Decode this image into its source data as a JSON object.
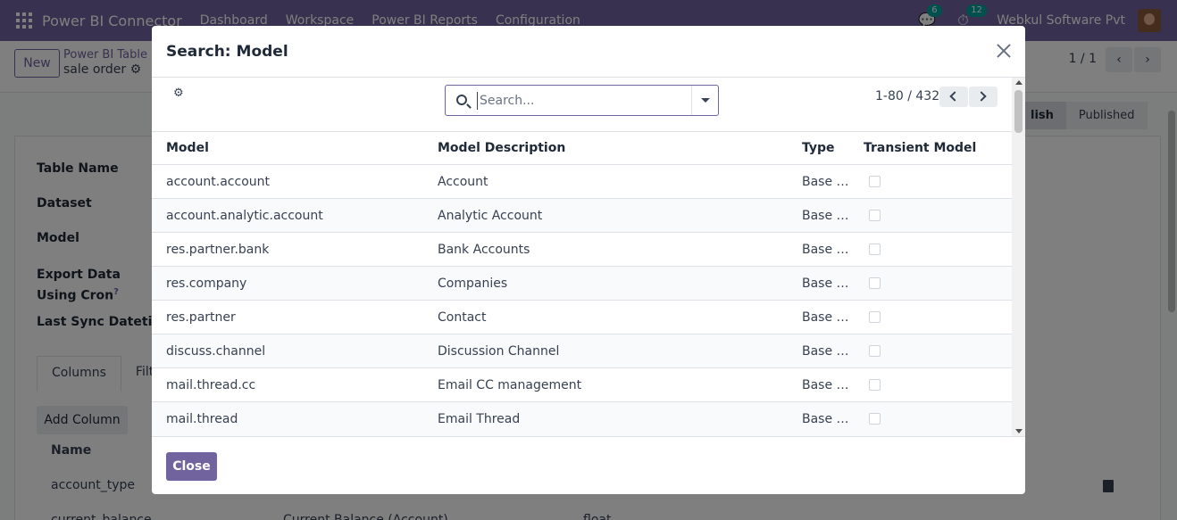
{
  "navbar": {
    "brand": "Power BI Connector",
    "menu": [
      "Dashboard",
      "Workspace",
      "Power BI Reports",
      "Configuration"
    ],
    "messages_count": "6",
    "activities_count": "12",
    "company": "Webkul Software Pvt"
  },
  "control_panel": {
    "new_label": "New",
    "breadcrumb_parent": "Power BI Table",
    "breadcrumb_current": "sale order",
    "pager": "1 / 1"
  },
  "statusbar": {
    "stages": [
      "lish",
      "Published"
    ]
  },
  "form": {
    "labels": [
      "Table Name",
      "Dataset",
      "Model",
      "Export Data Using Cron",
      "Last Sync Datetime"
    ],
    "cron_help": "?",
    "tabs": [
      "Columns",
      "Filte"
    ],
    "add_column_label": "Add Column",
    "column_header": "Name",
    "rows": [
      "account_type",
      "current_balance"
    ],
    "row2_desc": "Current Balance (Account)",
    "row2_type": "float"
  },
  "dialog": {
    "title": "Search: Model",
    "search_placeholder": "Search...",
    "pager": "1-80 / 432",
    "columns": [
      "Model",
      "Model Description",
      "Type",
      "Transient Model"
    ],
    "rows": [
      {
        "model": "account.account",
        "description": "Account",
        "type": "Base Obj…"
      },
      {
        "model": "account.analytic.account",
        "description": "Analytic Account",
        "type": "Base Obj…"
      },
      {
        "model": "res.partner.bank",
        "description": "Bank Accounts",
        "type": "Base Obj…"
      },
      {
        "model": "res.company",
        "description": "Companies",
        "type": "Base Obj…"
      },
      {
        "model": "res.partner",
        "description": "Contact",
        "type": "Base Obj…"
      },
      {
        "model": "discuss.channel",
        "description": "Discussion Channel",
        "type": "Base Obj…"
      },
      {
        "model": "mail.thread.cc",
        "description": "Email CC management",
        "type": "Base Obj…"
      },
      {
        "model": "mail.thread",
        "description": "Email Thread",
        "type": "Base Obj…"
      }
    ],
    "close_label": "Close"
  },
  "colors": {
    "brand": "#71639e",
    "badge": "#00a09d"
  }
}
